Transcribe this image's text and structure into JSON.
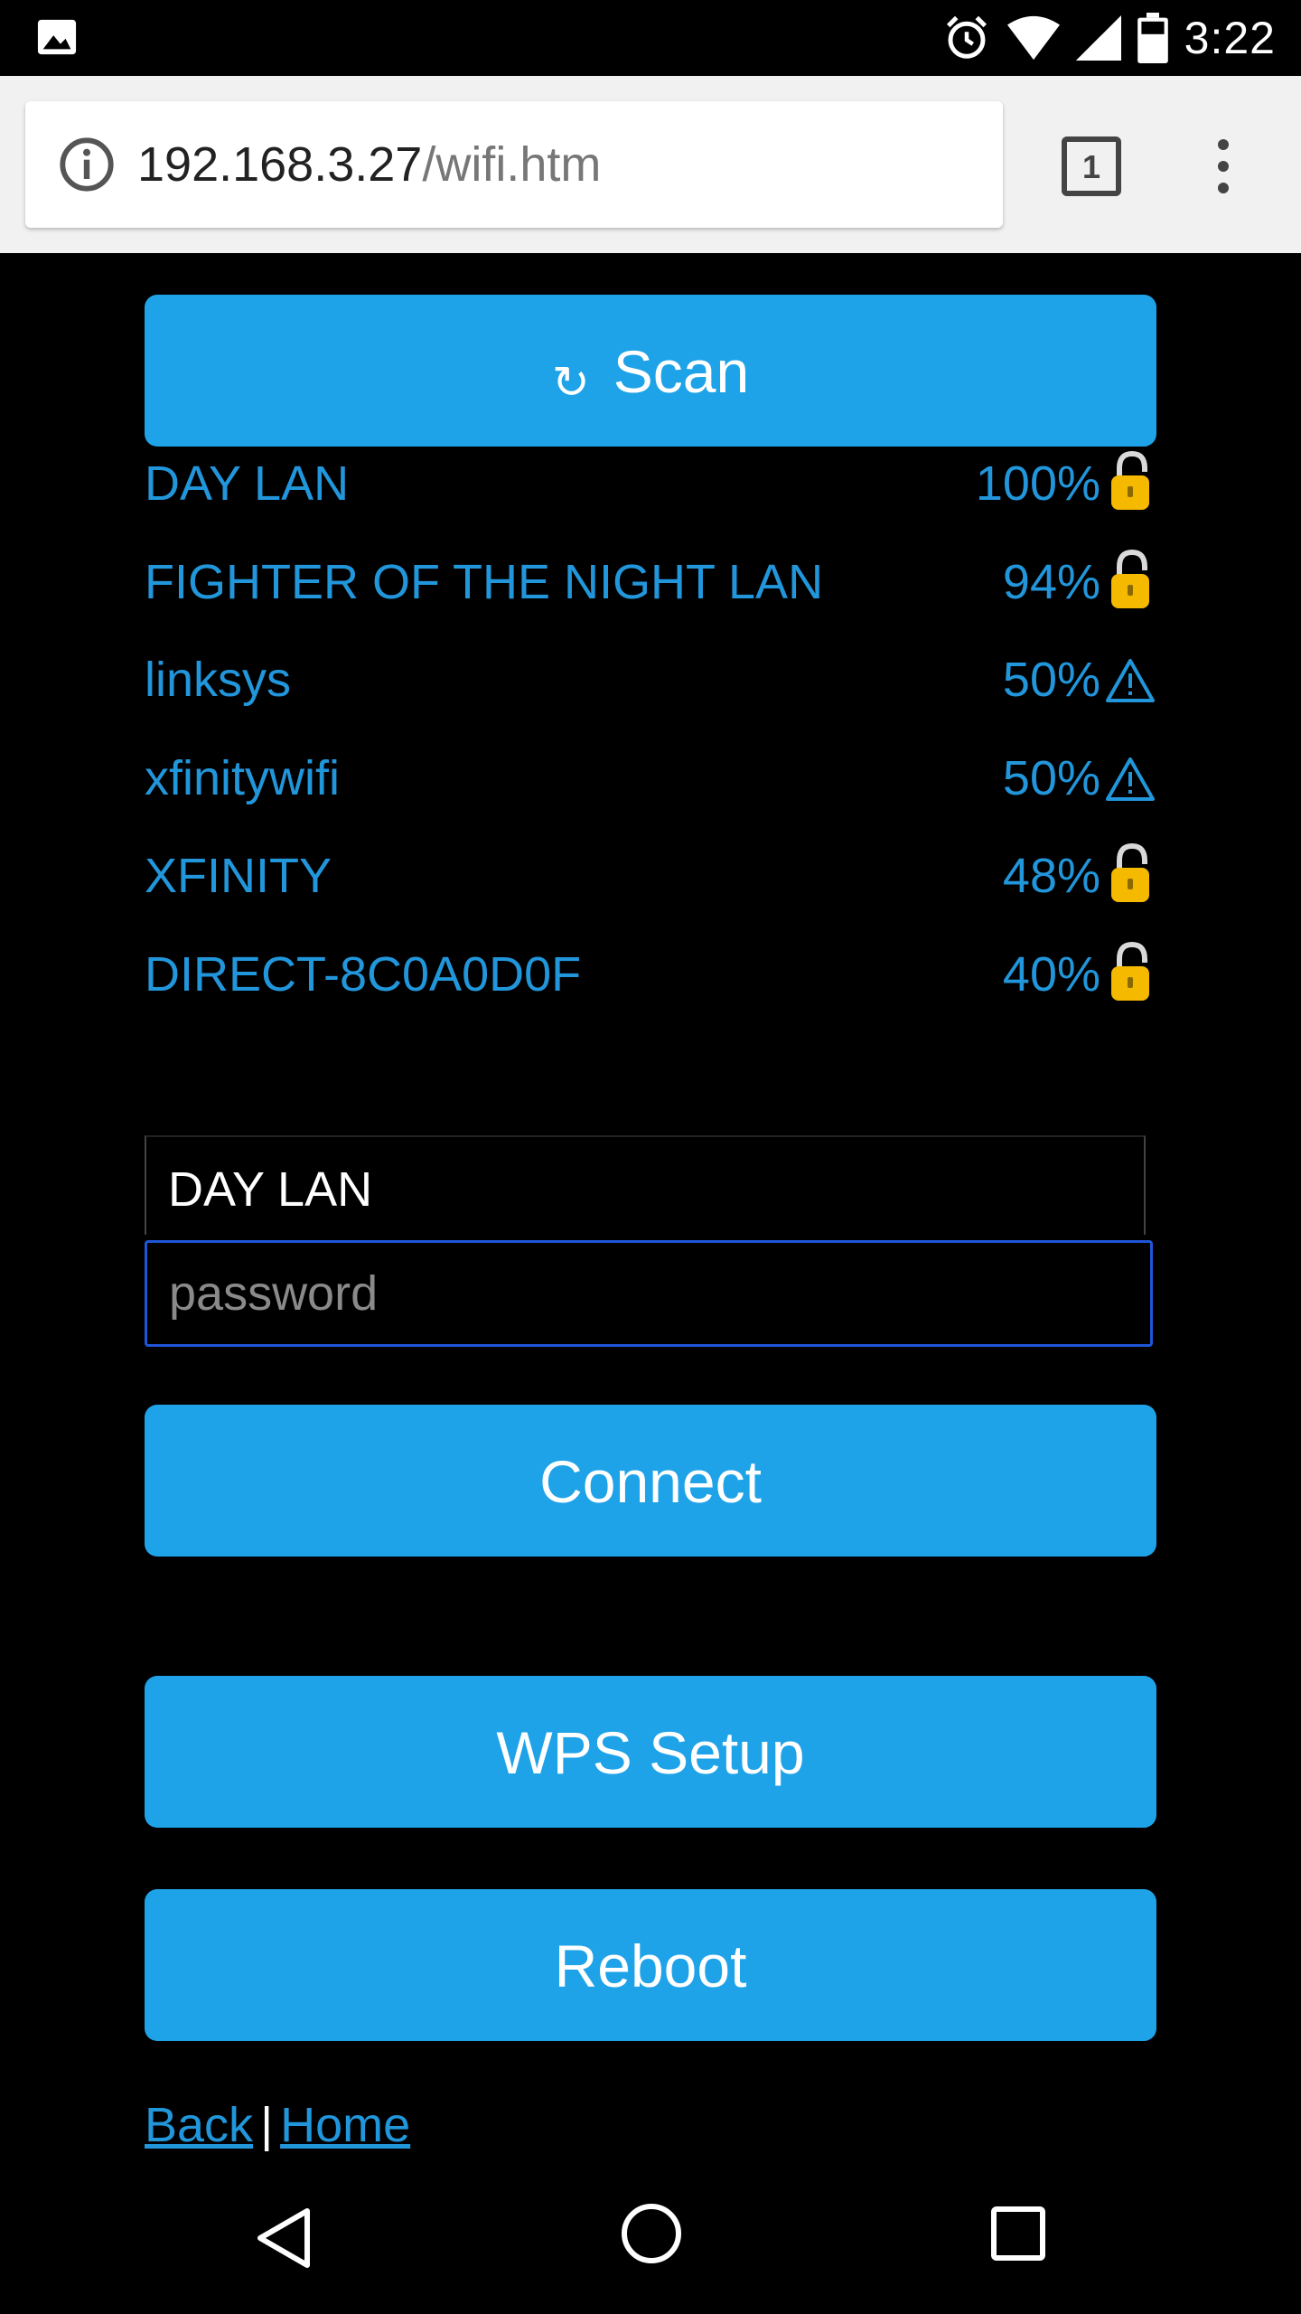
{
  "status_bar": {
    "time": "3:22"
  },
  "browser": {
    "url_host": "192.168.3.27",
    "url_path": "/wifi.htm",
    "tab_count": "1"
  },
  "scan_button": {
    "icon": "↻",
    "label": "Scan"
  },
  "networks": [
    {
      "ssid": "DAY LAN",
      "signal": "100%",
      "security": "lock-icon"
    },
    {
      "ssid": "FIGHTER OF THE NIGHT LAN",
      "signal": "94%",
      "security": "lock-icon"
    },
    {
      "ssid": "linksys",
      "signal": "50%",
      "security": "warning-icon"
    },
    {
      "ssid": "xfinitywifi",
      "signal": "50%",
      "security": "warning-icon"
    },
    {
      "ssid": "XFINITY",
      "signal": "48%",
      "security": "lock-icon"
    },
    {
      "ssid": "DIRECT-8C0A0D0F",
      "signal": "40%",
      "security": "lock-icon"
    }
  ],
  "form": {
    "ssid_value": "DAY LAN",
    "password_placeholder": "password"
  },
  "buttons": {
    "connect": "Connect",
    "wps": "WPS Setup",
    "reboot": "Reboot"
  },
  "footer_links": {
    "back": "Back",
    "separator": "|",
    "home": "Home"
  },
  "colors": {
    "accent": "#1fa3e8",
    "link": "#2296db",
    "focus_border": "#1f56d8",
    "lock": "#f5b900"
  }
}
